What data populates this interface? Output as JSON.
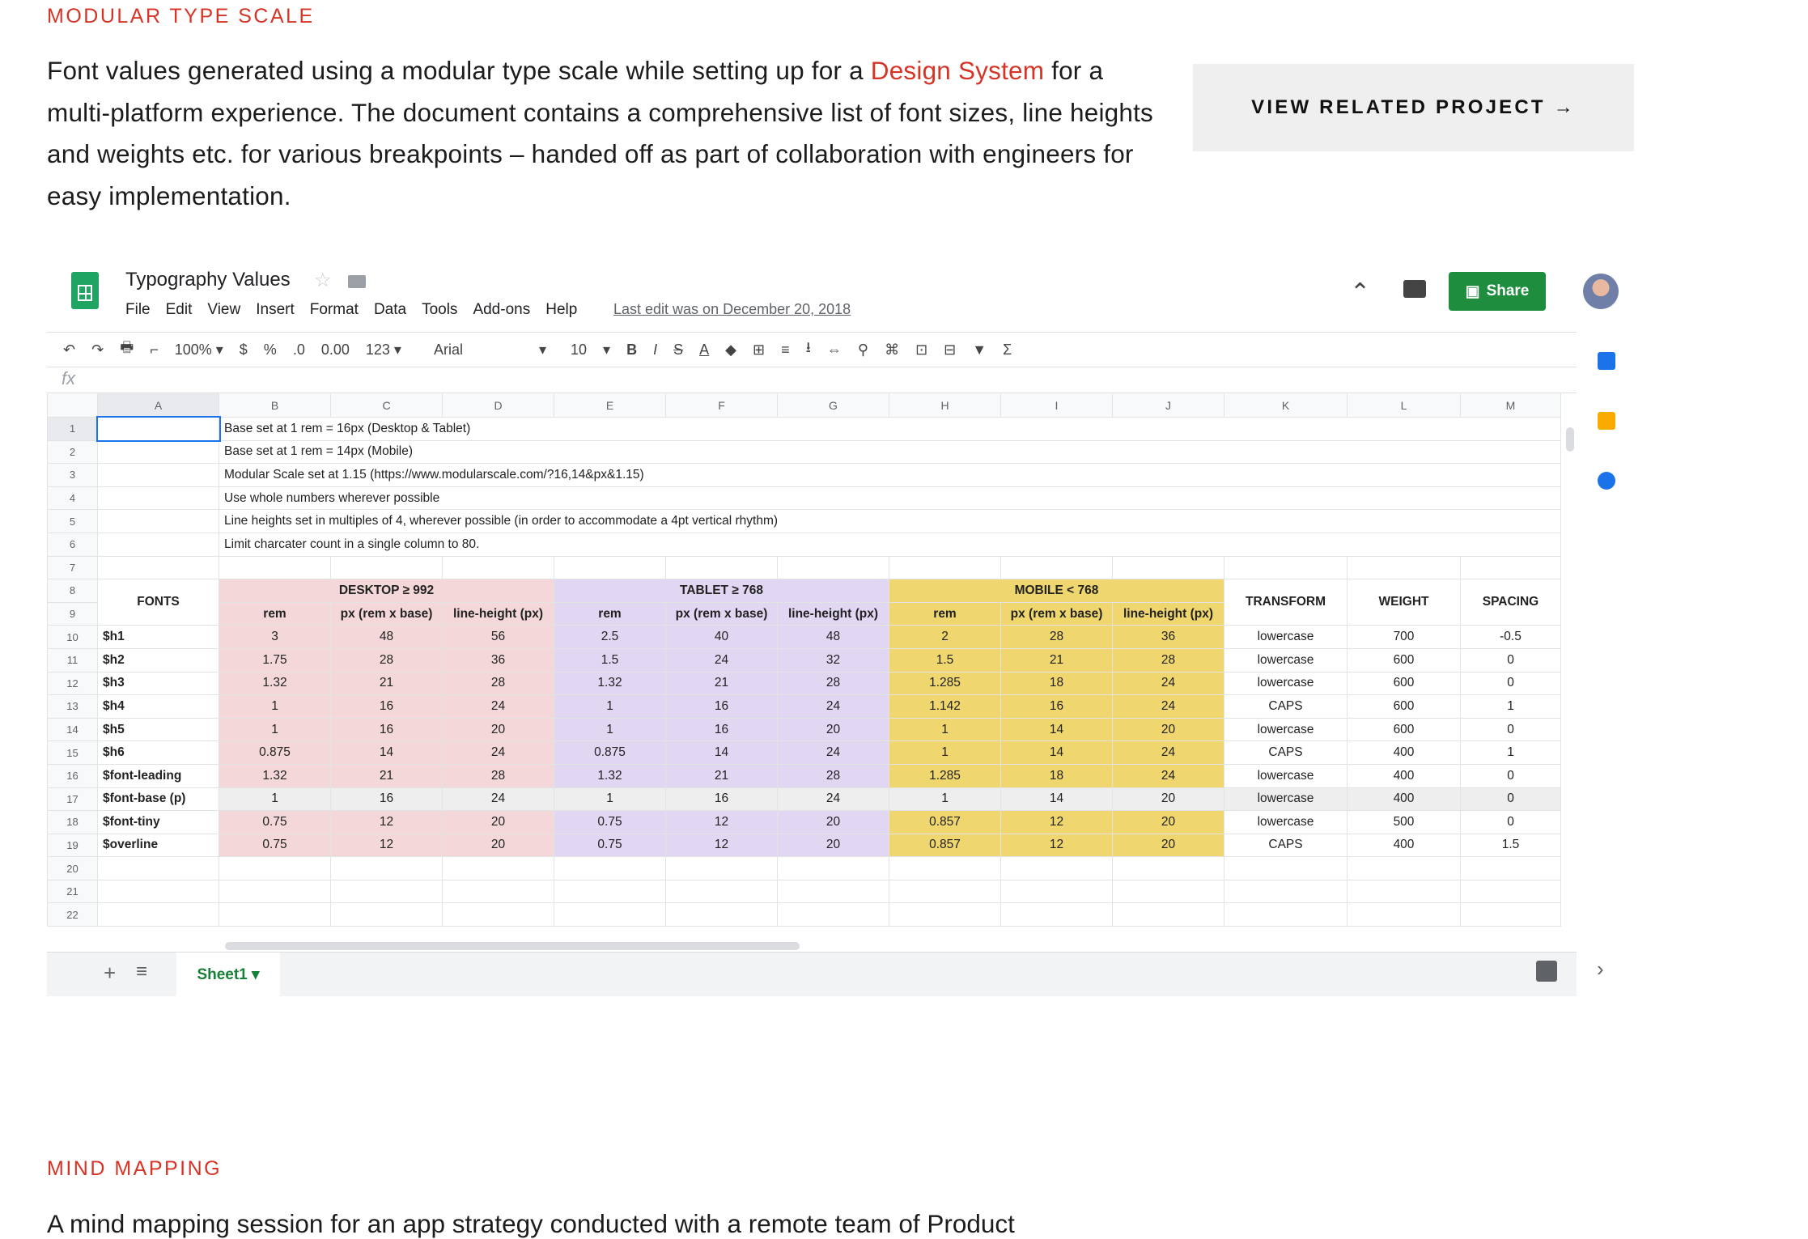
{
  "section1": {
    "eyebrow": "MODULAR TYPE SCALE",
    "intro_pre": "Font values generated using a modular type scale while setting up for a",
    "intro_link": "Design System",
    "intro_post": "for a multi-platform experience. The document contains a comprehensive list of font sizes, line heights and weights etc. for various breakpoints – handed off as part of collaboration with engineers for easy implementation.",
    "button": "VIEW RELATED PROJECT →"
  },
  "sheet": {
    "title": "Typography Values",
    "menu": [
      "File",
      "Edit",
      "View",
      "Insert",
      "Format",
      "Data",
      "Tools",
      "Add-ons",
      "Help"
    ],
    "last_edit": "Last edit was on December 20, 2018",
    "share": "Share",
    "toolbar": [
      "↶",
      "↷",
      "🖶",
      "⌐",
      "100%  ▾",
      "$",
      "%",
      ".0",
      "0.00",
      "123 ▾",
      "Arial",
      "▾",
      "10",
      "▾",
      "B",
      "I",
      "S",
      "A",
      "◆",
      "⊞",
      "≡",
      "⭳",
      "⇔",
      "⚲",
      "⌘",
      "⊡",
      "⊟",
      "▼",
      "Σ"
    ],
    "fx": "fx",
    "columns": [
      "A",
      "B",
      "C",
      "D",
      "E",
      "F",
      "G",
      "H",
      "I",
      "J",
      "K",
      "L",
      "M"
    ],
    "notes": [
      "Base set at 1 rem = 16px (Desktop & Tablet)",
      "Base set at 1 rem = 14px (Mobile)",
      "Modular Scale set at 1.15 (https://www.modularscale.com/?16,14&px&1.15)",
      "Use whole numbers wherever possible",
      "Line heights set in multiples of 4, wherever possible (in order to accommodate a 4pt vertical rhythm)",
      "Limit charcater count in a single column to 80."
    ],
    "group_headers": {
      "fonts": "FONTS",
      "desktop": "DESKTOP ≥ 992",
      "tablet": "TABLET ≥ 768",
      "mobile": "MOBILE < 768",
      "transform": "TRANSFORM",
      "weight": "WEIGHT",
      "spacing": "SPACING"
    },
    "sub_headers": [
      "rem",
      "px (rem x base)",
      "line-height (px)"
    ],
    "rows": [
      [
        "$h1",
        "3",
        "48",
        "56",
        "2.5",
        "40",
        "48",
        "2",
        "28",
        "36",
        "lowercase",
        "700",
        "-0.5"
      ],
      [
        "$h2",
        "1.75",
        "28",
        "36",
        "1.5",
        "24",
        "32",
        "1.5",
        "21",
        "28",
        "lowercase",
        "600",
        "0"
      ],
      [
        "$h3",
        "1.32",
        "21",
        "28",
        "1.32",
        "21",
        "28",
        "1.285",
        "18",
        "24",
        "lowercase",
        "600",
        "0"
      ],
      [
        "$h4",
        "1",
        "16",
        "24",
        "1",
        "16",
        "24",
        "1.142",
        "16",
        "24",
        "CAPS",
        "600",
        "1"
      ],
      [
        "$h5",
        "1",
        "16",
        "20",
        "1",
        "16",
        "20",
        "1",
        "14",
        "20",
        "lowercase",
        "600",
        "0"
      ],
      [
        "$h6",
        "0.875",
        "14",
        "24",
        "0.875",
        "14",
        "24",
        "1",
        "14",
        "24",
        "CAPS",
        "400",
        "1"
      ],
      [
        "$font-leading",
        "1.32",
        "21",
        "28",
        "1.32",
        "21",
        "28",
        "1.285",
        "18",
        "24",
        "lowercase",
        "400",
        "0"
      ],
      [
        "$font-base (p)",
        "1",
        "16",
        "24",
        "1",
        "16",
        "24",
        "1",
        "14",
        "20",
        "lowercase",
        "400",
        "0"
      ],
      [
        "$font-tiny",
        "0.75",
        "12",
        "20",
        "0.75",
        "12",
        "20",
        "0.857",
        "12",
        "20",
        "lowercase",
        "500",
        "0"
      ],
      [
        "$overline",
        "0.75",
        "12",
        "20",
        "0.75",
        "12",
        "20",
        "0.857",
        "12",
        "20",
        "CAPS",
        "400",
        "1.5"
      ]
    ],
    "sheet_tab": "Sheet1 ▾"
  },
  "section2": {
    "eyebrow": "MIND MAPPING",
    "text": "A mind mapping session for an app strategy conducted with a remote team of Product"
  }
}
